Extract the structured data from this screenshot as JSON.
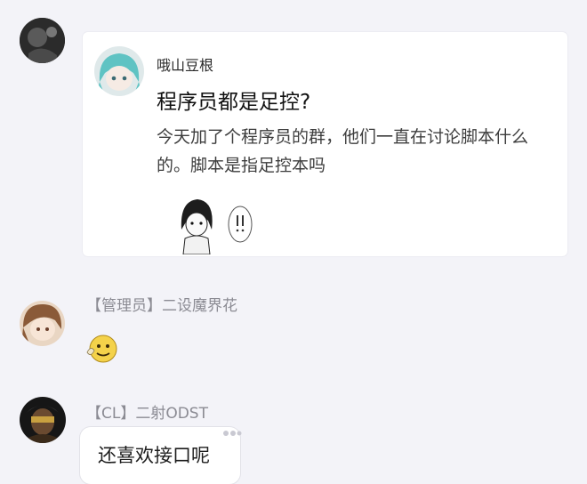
{
  "shared_post": {
    "author": "哦山豆根",
    "title": "程序员都是足控?",
    "body": "今天加了个程序员的群，他们一直在讨论脚本什么的。脚本是指足控本吗",
    "sticker_icon": "anime-girl-surprised-sticker"
  },
  "messages": [
    {
      "sender": "【管理员】二设魔界花",
      "content_icon": "doge-emoji"
    },
    {
      "sender": "【CL】二射ODST",
      "text": "还喜欢接口呢"
    }
  ],
  "colors": {
    "background": "#f3f3f8",
    "card": "#ffffff",
    "nickname": "#8b8b93"
  }
}
